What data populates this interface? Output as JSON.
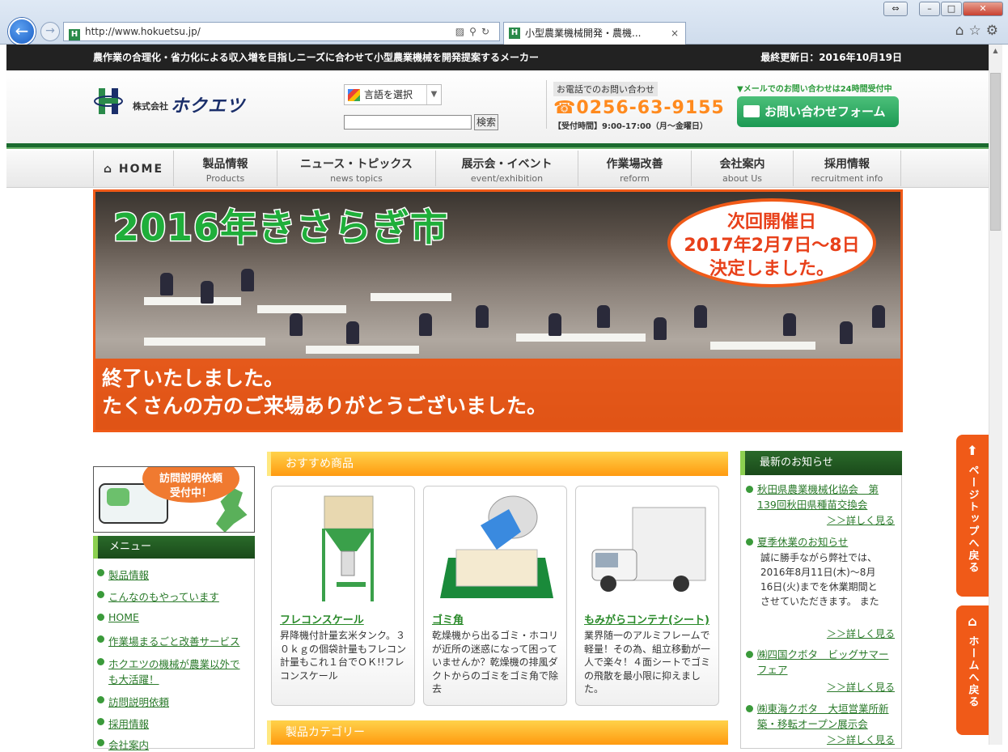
{
  "browser": {
    "url": "http://www.hokuetsu.jp/",
    "tab_title": "小型農業機械開発・農機...",
    "tab_close": "×",
    "favicon_text": "H",
    "window_restore": "⇔",
    "window_min": "–",
    "window_max": "□",
    "window_close": "✕",
    "right_tools": "⌂☆⚙"
  },
  "topbar": {
    "tagline": "農作業の合理化・省力化による収入増を目指しニーズに合わせて小型農業機械を開発提案するメーカー",
    "updated": "最終更新日：2016年10月19日"
  },
  "header": {
    "company_prefix": "株式会社",
    "company_name": "ホクエツ",
    "lang_label": "言語を選択",
    "search_button": "検索",
    "tel_heading": "お電話でのお問い合わせ",
    "tel_number": "☎0256-63-9155",
    "tel_hours": "【受付時間】9:00-17:00（月～金曜日）",
    "mail_note": "▼メールでのお問い合わせは24時間受付中",
    "mail_button": "お問い合わせフォーム"
  },
  "nav": {
    "home": "HOME",
    "items": [
      {
        "ja": "製品情報",
        "en": "Products"
      },
      {
        "ja": "ニュース・トピックス",
        "en": "news topics"
      },
      {
        "ja": "展示会・イベント",
        "en": "event/exhibition"
      },
      {
        "ja": "作業場改善",
        "en": "reform"
      },
      {
        "ja": "会社案内",
        "en": "about Us"
      },
      {
        "ja": "採用情報",
        "en": "recruitment info"
      }
    ]
  },
  "banner": {
    "title": "2016年きさらぎ市",
    "bubble_line1": "次回開催日",
    "bubble_line2": "2017年2月7日～8日",
    "bubble_line3": "決定しました。",
    "bar_line1": "終了いたしました。",
    "bar_line2": "たくさんの方のご来場ありがとうございました。"
  },
  "visit": {
    "bubble_line1": "訪問説明依頼",
    "bubble_line2": "受付中！"
  },
  "menu": {
    "heading": "メニュー",
    "items": [
      "製品情報",
      "こんなのもやっています",
      "HOME",
      "作業場まるごと改善サービス",
      "ホクエツの機械が農業以外で",
      "も大活躍！",
      "訪問説明依頼",
      "採用情報",
      "会社案内"
    ]
  },
  "recommended": {
    "heading": "おすすめ商品",
    "products": [
      {
        "name": "フレコンスケール",
        "desc": "昇降機付計量玄米タンク。３０ｋｇの個袋計量もフレコン計量もこれ１台でＯＫ!!フレコンスケール"
      },
      {
        "name": "ゴミ角",
        "desc": "乾燥機から出るゴミ・ホコリが近所の迷惑になって困っていませんか？乾燥機の排風ダクトからのゴミをゴミ角で除去"
      },
      {
        "name": "もみがらコンテナ(シート)",
        "desc": "業界随一のアルミフレームで軽量！その為、組立移動が一人で楽々！４面シートでゴミの飛散を最小限に抑えました。"
      }
    ]
  },
  "category": {
    "heading": "製品カテゴリー"
  },
  "news": {
    "heading": "最新のお知らせ",
    "items": [
      {
        "title1": "秋田県農業機械化協会　第",
        "title2": "139回秋田県種苗交換会",
        "more": "＞＞詳しく見る"
      },
      {
        "title1": "夏季休業のお知らせ",
        "body": [
          "誠に勝手ながら弊社では、",
          "2016年8月11日(木)～8月",
          "16日(火)までを休業期間と",
          "させていただきます。 また"
        ],
        "more": "＞＞詳しく見る"
      },
      {
        "title1": "㈱四国クボタ　ビッグサマー",
        "title2": "フェア",
        "more": "＞＞詳しく見る"
      },
      {
        "title1": "㈱東海クボタ　大垣営業所新",
        "title2": "築・移転オープン展示会",
        "more": "＞＞詳しく見る"
      }
    ]
  },
  "floats": {
    "top": "ページトップへ戻る",
    "home": "ホームへ戻る"
  },
  "colors": {
    "accent": "#f05a18",
    "green": "#1a6a2e",
    "orange_header": "#ff9a10"
  }
}
